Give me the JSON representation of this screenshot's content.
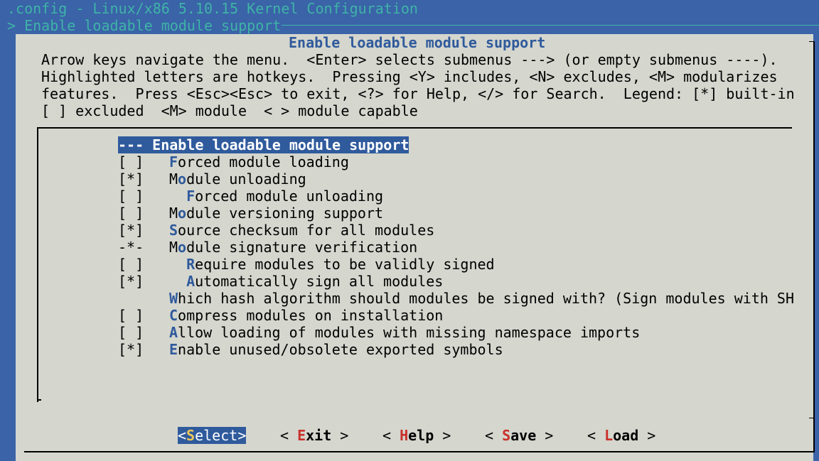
{
  "window": {
    "title": ".config - Linux/x86 5.10.15 Kernel Configuration",
    "breadcrumb": "> Enable loadable module support"
  },
  "dialog": {
    "title": "Enable loadable module support",
    "help_lines": [
      "Arrow keys navigate the menu.  <Enter> selects submenus ---> (or empty submenus ----).",
      "Highlighted letters are hotkeys.  Pressing <Y> includes, <N> excludes, <M> modularizes",
      "features.  Press <Esc><Esc> to exit, <?> for Help, </> for Search.  Legend: [*] built-in",
      "[ ] excluded  <M> module  < > module capable"
    ]
  },
  "menu": {
    "items": [
      {
        "mark": "---",
        "indent": "",
        "hotkey": "",
        "rest": " Enable loadable module support",
        "selected": true
      },
      {
        "mark": "[ ]",
        "indent": "",
        "hotkey": "F",
        "rest": "orced module loading"
      },
      {
        "mark": "[*]",
        "indent": "",
        "hotkey": "",
        "pre": "M",
        "hot2": "o",
        "rest": "dule unloading"
      },
      {
        "mark": "[ ]",
        "indent": "  ",
        "hotkey": "F",
        "rest": "orced module unloading"
      },
      {
        "mark": "[ ]",
        "indent": "",
        "hotkey": "",
        "pre": "M",
        "hot2": "o",
        "rest": "dule versioning support"
      },
      {
        "mark": "[*]",
        "indent": "",
        "hotkey": "S",
        "rest": "ource checksum for all modules"
      },
      {
        "mark": "-*-",
        "indent": "",
        "hotkey": "",
        "pre": "M",
        "hot2": "o",
        "rest": "dule signature verification"
      },
      {
        "mark": "[ ]",
        "indent": "  ",
        "hotkey": "R",
        "rest": "equire modules to be validly signed"
      },
      {
        "mark": "[*]",
        "indent": "  ",
        "hotkey": "A",
        "rest": "utomatically sign all modules"
      },
      {
        "mark": "",
        "indent": "",
        "hotkey": "W",
        "rest": "hich hash algorithm should modules be signed with? (Sign modules with SH"
      },
      {
        "mark": "[ ]",
        "indent": "",
        "hotkey": "C",
        "rest": "ompress modules on installation"
      },
      {
        "mark": "[ ]",
        "indent": "",
        "hotkey": "A",
        "rest": "llow loading of modules with missing namespace imports"
      },
      {
        "mark": "[*]",
        "indent": "",
        "hotkey": "E",
        "rest": "nable unused/obsolete exported symbols"
      }
    ]
  },
  "buttons": {
    "select": {
      "left": "<",
      "hot": "S",
      "rest": "elect",
      "right": ">"
    },
    "exit": {
      "left": "< ",
      "hot": "E",
      "rest": "xit",
      "right": " >"
    },
    "help": {
      "left": "< ",
      "hot": "H",
      "rest": "elp",
      "right": " >"
    },
    "save": {
      "left": "< ",
      "hot": "S",
      "rest": "ave",
      "right": " >"
    },
    "load": {
      "left": "< ",
      "hot": "L",
      "rest": "oad",
      "right": " >"
    }
  },
  "colors": {
    "desktop": "#3a63a8",
    "dialog_bg": "#d5d6ce",
    "title_text": "#3fb3a6",
    "accent": "#2f5a9c",
    "button_hotkey": "#c8302a",
    "selected_hotkey": "#e8c65a"
  }
}
